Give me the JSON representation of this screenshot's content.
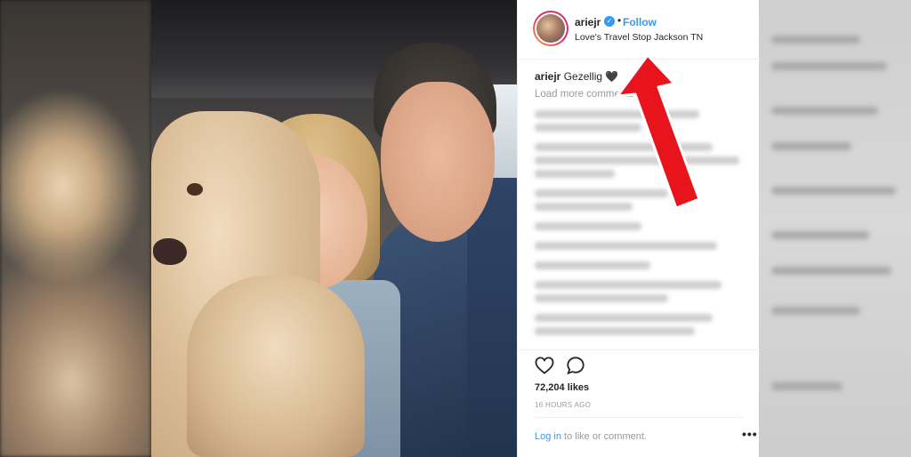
{
  "post": {
    "username": "ariejr",
    "follow_label": "Follow",
    "separator": "•",
    "location": "Love's Travel Stop Jackson TN",
    "caption_user": "ariejr",
    "caption_text": "Gezellig 🖤",
    "load_more": "Load more comments",
    "likes": "72,204 likes",
    "timestamp": "16 HOURS AGO",
    "login_link": "Log in",
    "login_rest": " to like or comment.",
    "more_options": "•••"
  },
  "colors": {
    "accent": "#3897f0",
    "annotation_arrow": "#e8141c",
    "muted_text": "#999999",
    "primary_text": "#262626"
  },
  "icons": {
    "verified": "verified-badge-icon",
    "like": "heart-icon",
    "comment": "comment-bubble-icon",
    "more": "more-options-icon",
    "annotation": "red-arrow-icon"
  }
}
